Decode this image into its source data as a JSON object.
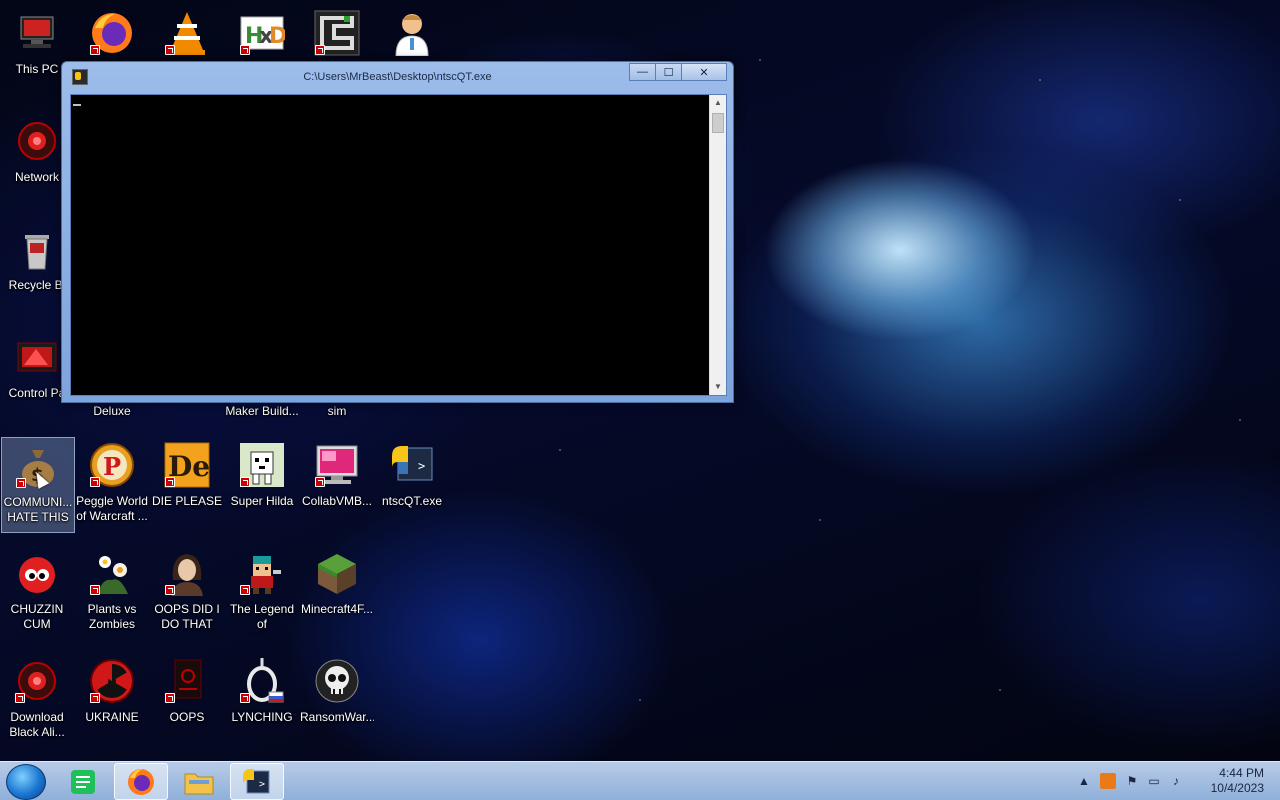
{
  "desktop": {
    "icons": [
      {
        "label": "This PC",
        "icon": "computer-icon"
      },
      {
        "label": "",
        "icon": "firefox-icon"
      },
      {
        "label": "",
        "icon": "vlc-icon"
      },
      {
        "label": "",
        "icon": "hxd-icon"
      },
      {
        "label": "",
        "icon": "maze-icon"
      },
      {
        "label": "",
        "icon": "doctor-icon"
      },
      {
        "label": "Network",
        "icon": "network-icon"
      },
      {
        "label": "Recycle Bi",
        "icon": "recycle-bin-icon"
      },
      {
        "label": "Control Pa",
        "icon": "control-panel-icon"
      },
      {
        "label": "Deluxe",
        "icon": ""
      },
      {
        "label": "Maker Build...",
        "icon": ""
      },
      {
        "label": "sim",
        "icon": ""
      },
      {
        "label": "COMMUNI...\nHATE THIS ...",
        "icon": "money-bag-icon"
      },
      {
        "label": "Peggle World\nof Warcraft ...",
        "icon": "peggle-icon"
      },
      {
        "label": "DIE PLEASE",
        "icon": "de-icon"
      },
      {
        "label": "Super Hilda",
        "icon": "pixel-dog-icon"
      },
      {
        "label": "CollabVMB...",
        "icon": "monitor-icon"
      },
      {
        "label": "ntscQT.exe",
        "icon": "python-icon"
      },
      {
        "label": "CHUZZIN\nCUM",
        "icon": "chuzzle-icon"
      },
      {
        "label": "Plants vs\nZombies",
        "icon": "flower-icon"
      },
      {
        "label": "OOPS DID I\nDO THAT",
        "icon": "portrait-icon"
      },
      {
        "label": "The Legend of\nZilda",
        "icon": "pixel-hero-icon"
      },
      {
        "label": "Minecraft4F...",
        "icon": "grass-block-icon"
      },
      {
        "label": "Download\nBlack Ali...",
        "icon": "alien-icon"
      },
      {
        "label": "UKRAINE",
        "icon": "radiation-icon"
      },
      {
        "label": "OOPS",
        "icon": "dark-book-icon"
      },
      {
        "label": "LYNCHING",
        "icon": "noose-icon"
      },
      {
        "label": "RansomWar...",
        "icon": "skull-icon"
      }
    ]
  },
  "window": {
    "title": "C:\\Users\\MrBeast\\Desktop\\ntscQT.exe",
    "minimize_label": "—",
    "maximize_label": "☐",
    "close_label": "✕"
  },
  "taskbar": {
    "pinned": [
      {
        "name": "notes-app",
        "icon": "notes-icon"
      },
      {
        "name": "firefox",
        "icon": "firefox-icon"
      },
      {
        "name": "file-explorer",
        "icon": "folder-icon"
      },
      {
        "name": "ntscqt",
        "icon": "python-console-icon"
      }
    ],
    "tray": {
      "time": "4:44 PM",
      "date": "10/4/2023"
    }
  },
  "colors": {
    "taskbar": "#a7c0e2",
    "console_bg": "#000000",
    "title_bar": "#8fb0e0"
  }
}
